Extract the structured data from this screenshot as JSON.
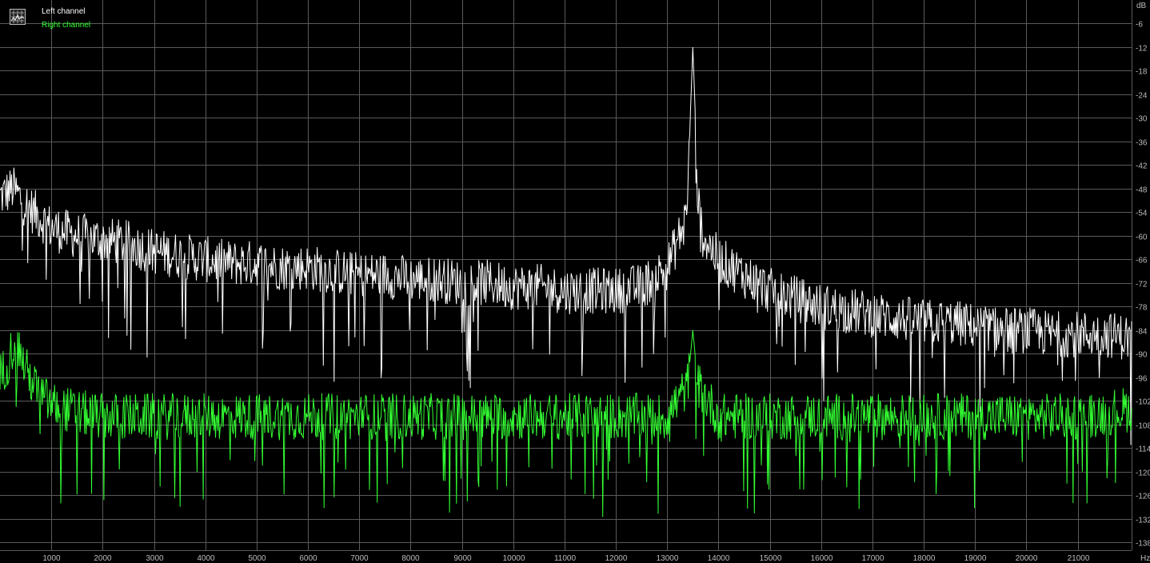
{
  "window": {
    "background": "#000000",
    "grid_color": "#5a5a5a",
    "label_color": "#bbbbbb"
  },
  "legend": {
    "icon": "spectrum-grid-icon",
    "left_channel": "Left channel",
    "right_channel": "Right channel"
  },
  "chart_data": {
    "type": "line",
    "xlabel": "Hz",
    "ylabel": "dB",
    "xlim": [
      0,
      22050
    ],
    "ylim": [
      -140,
      0
    ],
    "grid": true,
    "legend_position": "top-left",
    "x_ticks": [
      1000,
      2000,
      3000,
      4000,
      5000,
      6000,
      7000,
      8000,
      9000,
      10000,
      11000,
      12000,
      13000,
      14000,
      15000,
      16000,
      17000,
      18000,
      19000,
      20000,
      21000
    ],
    "y_ticks": [
      -6,
      -12,
      -18,
      -24,
      -30,
      -36,
      -42,
      -48,
      -54,
      -60,
      -66,
      -72,
      -78,
      -84,
      -90,
      -96,
      -102,
      -108,
      -114,
      -120,
      -126,
      -132,
      -138
    ],
    "series": [
      {
        "name": "Left channel",
        "color": "#ffffff",
        "x": [
          0,
          250,
          500,
          750,
          1000,
          1500,
          2000,
          2500,
          3000,
          3500,
          4000,
          4500,
          5000,
          5500,
          6000,
          6500,
          7000,
          7500,
          8000,
          8500,
          9000,
          9500,
          10000,
          10500,
          11000,
          11500,
          12000,
          12500,
          13000,
          13300,
          13400,
          13450,
          13500,
          13550,
          13600,
          13700,
          14000,
          14500,
          15000,
          15500,
          16000,
          16500,
          17000,
          17500,
          18000,
          18500,
          19000,
          19500,
          20000,
          20500,
          21000,
          21500,
          22050
        ],
        "values": [
          -50,
          -48,
          -52,
          -55,
          -58,
          -60,
          -61,
          -62,
          -64,
          -65,
          -66,
          -67,
          -67,
          -68,
          -68,
          -69,
          -70,
          -70,
          -71,
          -71,
          -72,
          -72,
          -73,
          -73,
          -74,
          -74,
          -74,
          -73,
          -68,
          -58,
          -50,
          -30,
          -12,
          -30,
          -52,
          -60,
          -66,
          -70,
          -74,
          -76,
          -78,
          -79,
          -80,
          -81,
          -82,
          -82,
          -83,
          -84,
          -84,
          -85,
          -85,
          -85,
          -86
        ]
      },
      {
        "name": "Right channel",
        "color": "#33ff33",
        "x": [
          0,
          150,
          300,
          500,
          750,
          1000,
          1500,
          2000,
          3000,
          4000,
          5000,
          6000,
          7000,
          8000,
          9000,
          10000,
          11000,
          12000,
          13000,
          13400,
          13500,
          13600,
          14000,
          15000,
          16000,
          17000,
          18000,
          19000,
          20000,
          21000,
          22050
        ],
        "values": [
          -96,
          -92,
          -86,
          -94,
          -100,
          -103,
          -105,
          -106,
          -106,
          -106,
          -106,
          -106,
          -106,
          -106,
          -106,
          -106,
          -106,
          -106,
          -106,
          -98,
          -84,
          -98,
          -106,
          -106,
          -106,
          -106,
          -106,
          -106,
          -106,
          -106,
          -104
        ]
      }
    ]
  }
}
